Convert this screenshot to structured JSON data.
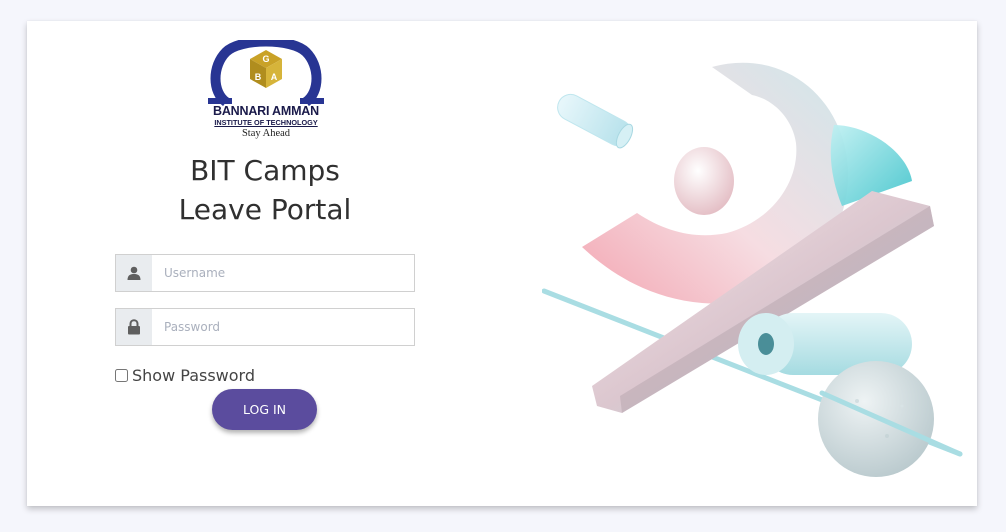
{
  "logo": {
    "monogram": "GBA",
    "name": "BANNARI AMMAN",
    "subtitle": "INSTITUTE OF TECHNOLOGY",
    "tagline": "Stay Ahead"
  },
  "title": {
    "line1": "BIT Camps",
    "line2": "Leave Portal"
  },
  "form": {
    "username_placeholder": "Username",
    "username_value": "",
    "password_placeholder": "Password",
    "password_value": "",
    "show_password_label": "Show Password",
    "show_password_checked": false,
    "login_label": "LOG IN"
  },
  "icons": {
    "username": "user-icon",
    "password": "lock-icon"
  },
  "colors": {
    "accent": "#5b4c9e",
    "logo_blue": "#283593",
    "logo_gold": "#c9a227",
    "background": "#f5f6fc"
  }
}
